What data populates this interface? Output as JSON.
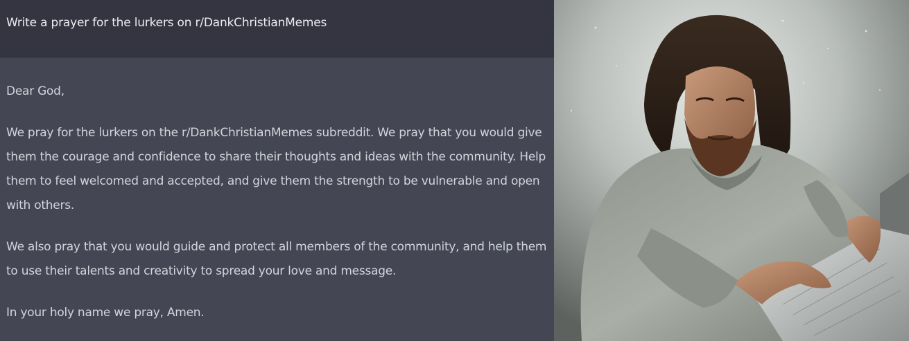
{
  "prompt": {
    "text": "Write a prayer for the lurkers on r/DankChristianMemes"
  },
  "response": {
    "paragraphs": [
      "Dear God,",
      "We pray for the lurkers on the r/DankChristianMemes subreddit. We pray that you would give them the courage and confidence to share their thoughts and ideas with the community. Help them to feel welcomed and accepted, and give them the strength to be vulnerable and open with others.",
      "We also pray that you would guide and protect all members of the community, and help them to use their talents and creativity to spread your love and message.",
      "In your holy name we pray, Amen."
    ]
  },
  "colors": {
    "prompt_bg": "#343541",
    "response_bg": "#444654",
    "prompt_text": "#ececf1",
    "response_text": "#d1d5db"
  },
  "artwork": {
    "subject": "bearded long-haired man in grey robe typing on a laptop"
  }
}
